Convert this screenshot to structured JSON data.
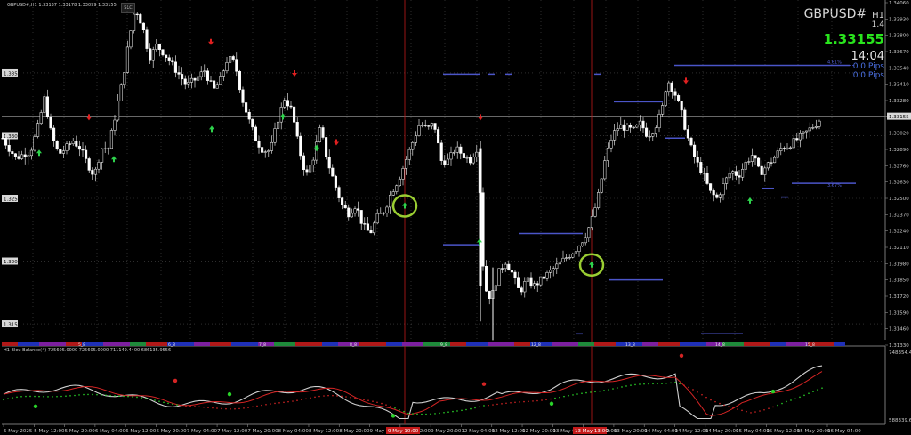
{
  "header": {
    "info_line": "GBPUSD#,H1  1.33137 1.33178 1.33099 1.33155",
    "slc_button": "SLC"
  },
  "hud": {
    "symbol": "GBPUSD#",
    "timeframe": "H1",
    "spread": "1.4",
    "bid": "1.33155",
    "time": "14:04",
    "pips1": "0.0 Pips",
    "pips2": "0.0 Pips"
  },
  "price_axis": {
    "labels": [
      "1.34060",
      "1.33930",
      "1.33800",
      "1.33670",
      "1.33540",
      "1.33410",
      "1.33280",
      "1.33155",
      "1.33020",
      "1.32890",
      "1.32760",
      "1.32630",
      "1.32500",
      "1.32370",
      "1.32240",
      "1.32110",
      "1.31980",
      "1.31850",
      "1.31720",
      "1.31590",
      "1.31460",
      "1.31330"
    ],
    "current": "1.33155"
  },
  "level_tags": [
    "1.335",
    "1.330",
    "1.325",
    "1.320",
    "1.315"
  ],
  "percent_tags": {
    "upper": "4.61%",
    "lower": "3.67%"
  },
  "indicator": {
    "info_line": "H1 Bleu Balance(4) 725605.0000 725605.0000 711149.4400 686135.9556",
    "axis_labels": [
      "748354.4",
      "588339.6"
    ]
  },
  "time_axis": {
    "labels": [
      "5 May 2025",
      "5 May 12:00",
      "5 May 20:00",
      "6 May 04:00",
      "6 May 12:00",
      "6 May 20:00",
      "7 May 04:00",
      "7 May 12:00",
      "7 May 20:00",
      "8 May 04:00",
      "8 May 12:00",
      "8 May 20:00",
      "9 May 04:00",
      "9 May 12:00",
      "9 May 20:00",
      "12 May 04:00",
      "12 May 12:00",
      "12 May 20:00",
      "13 May 04:00",
      "13 May 12:00",
      "13 May 20:00",
      "14 May 04:00",
      "14 May 12:00",
      "14 May 20:00",
      "15 May 04:00",
      "15 May 12:00",
      "15 May 20:00",
      "16 May 04:00"
    ],
    "highlights": [
      "9 May 10:00",
      "13 May 13:00"
    ]
  },
  "session_bar_labels": [
    "5_8",
    "6_8",
    "7_8",
    "8_8",
    "9_8",
    "12_8",
    "13_8",
    "14_8",
    "15_8",
    "16_8"
  ],
  "colors": {
    "background": "#000000",
    "candle": "#ffffff",
    "grid": "#4a4a4a",
    "up_arrow": "#2ed24c",
    "down_arrow": "#e02020",
    "signal_circle": "#9acd32",
    "vline": "#c01818",
    "level_lines": "#4b55c8",
    "osc_white": "#d0d0d0",
    "osc_red": "#d42424",
    "osc_green": "#29d329"
  }
}
